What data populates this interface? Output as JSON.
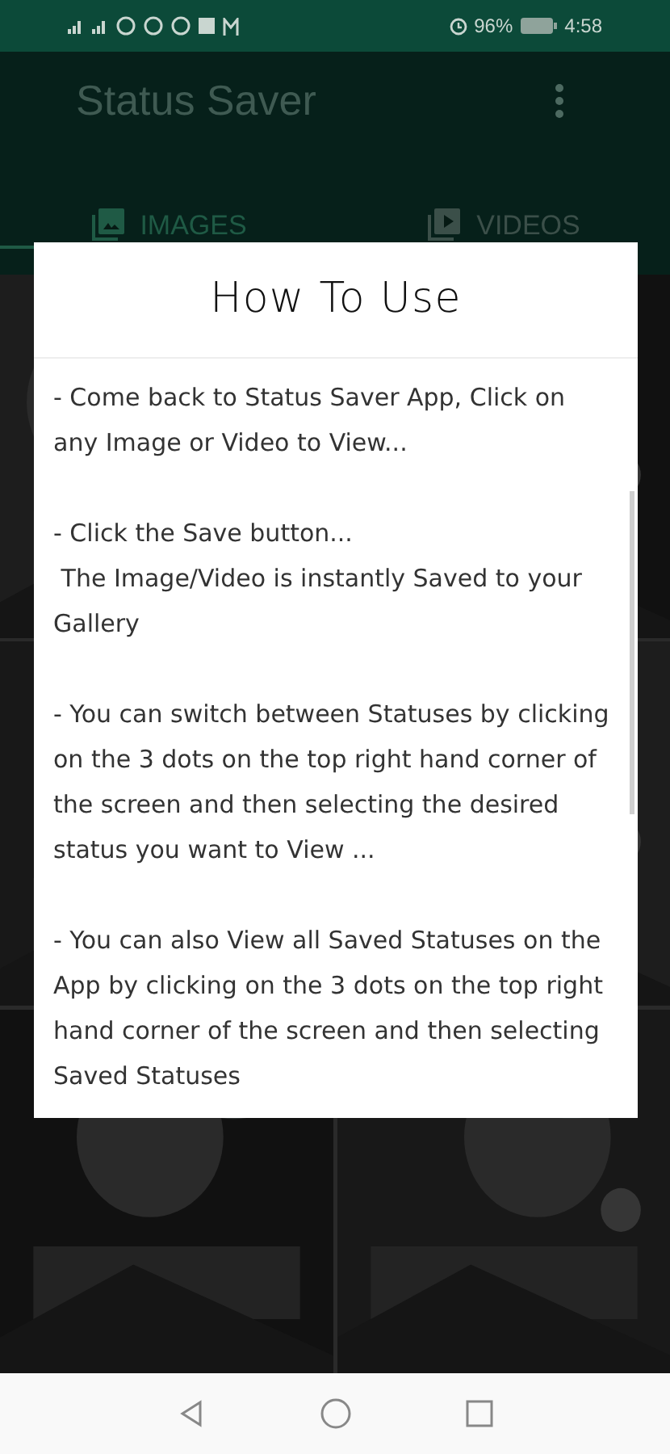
{
  "status_bar": {
    "battery": "96%",
    "time": "4:58"
  },
  "app_bar": {
    "title": "Status Saver"
  },
  "tabs": [
    {
      "label": "IMAGES",
      "kind": "images",
      "selected": true
    },
    {
      "label": "VIDEOS",
      "kind": "videos",
      "selected": false
    }
  ],
  "dialog": {
    "title": "How To Use",
    "paragraphs": [
      "- Come back to Status Saver App, Click on any Image or Video to View...",
      "- Click the Save button...\n The Image/Video is instantly Saved to your Gallery",
      "- You can switch between Statuses by clicking on the 3 dots on the top right hand corner of the screen and then selecting the desired status you want to View ...",
      "- You can also View all Saved Statuses on the App by clicking on the 3 dots on the top right hand corner of the screen and then selecting Saved Statuses"
    ]
  }
}
